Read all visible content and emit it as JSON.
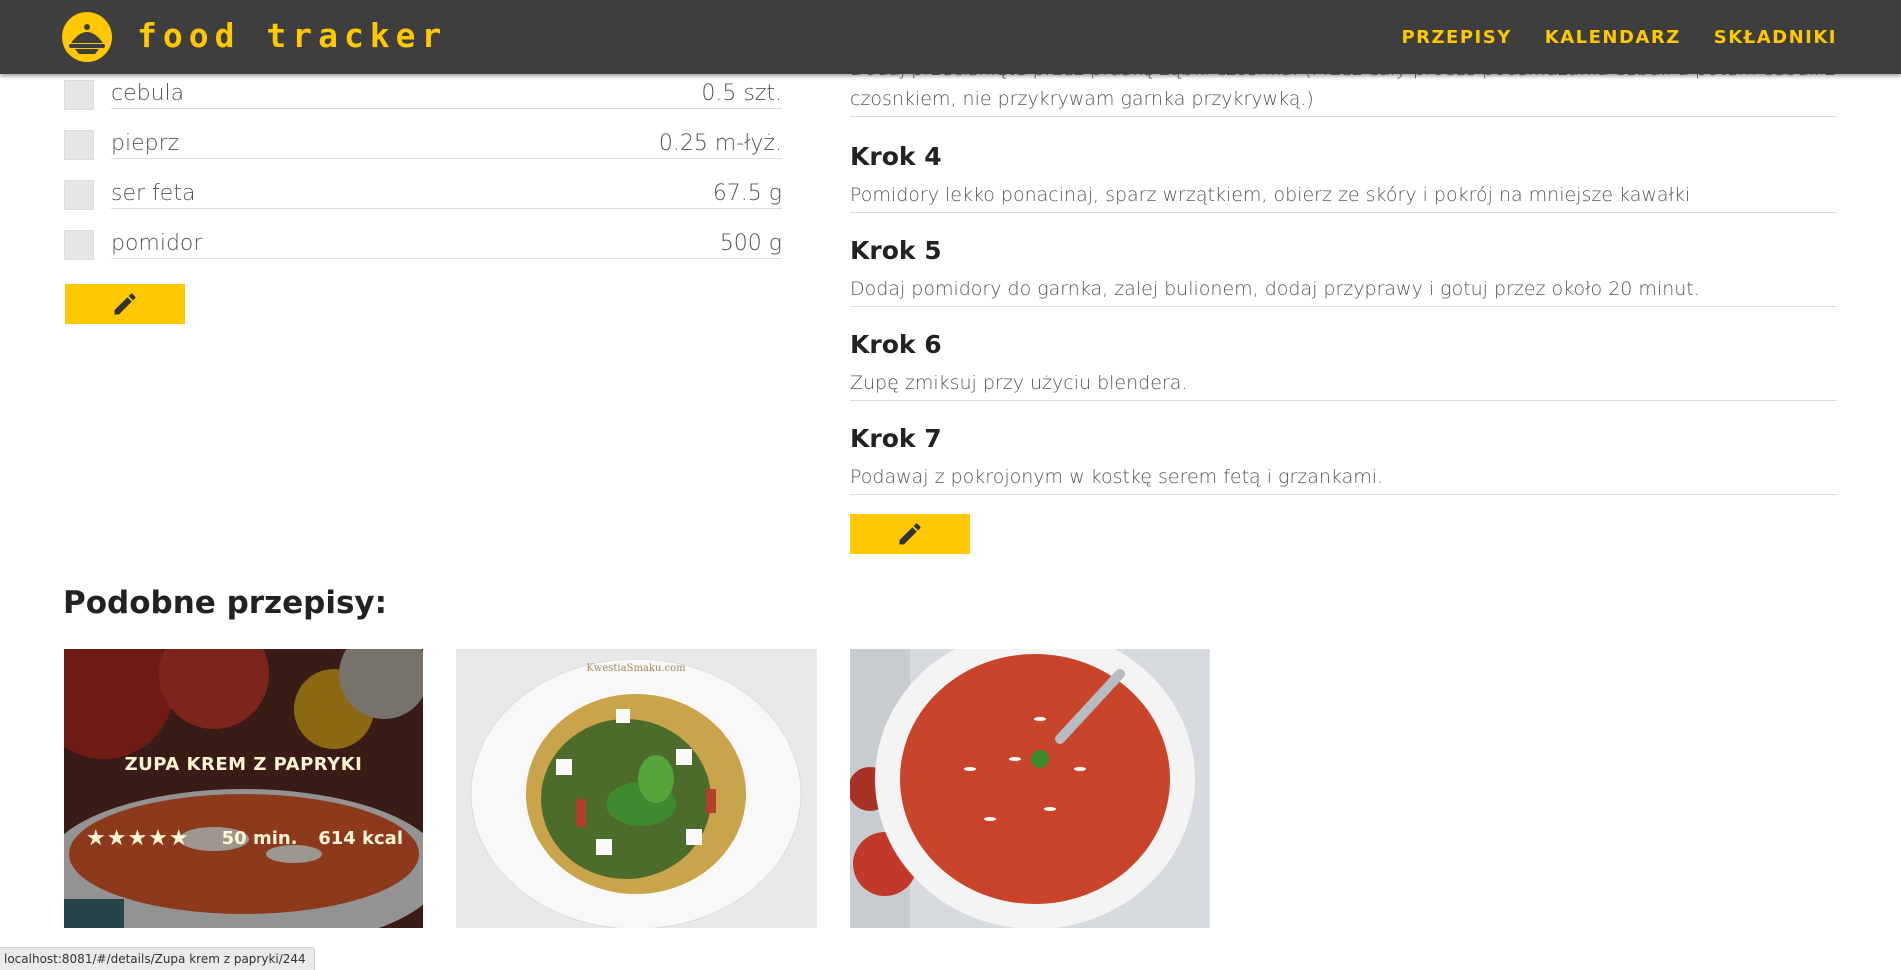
{
  "navbar": {
    "brand": "food tracker",
    "links": [
      "PRZEPISY",
      "KALENDARZ",
      "SKŁADNIKI"
    ],
    "colors": {
      "background": "#3e3e3e",
      "accent": "#ffc800"
    }
  },
  "ingredients": [
    {
      "name": "cebula",
      "qty": "0.5 szt."
    },
    {
      "name": "pieprz",
      "qty": "0.25 m-łyż."
    },
    {
      "name": "ser feta",
      "qty": "67.5 g"
    },
    {
      "name": "pomidor",
      "qty": "500 g"
    }
  ],
  "steps": {
    "partial_text": "Dodaj przeciśnięte przez praskę ząbki czosnku. (Przez cały proces podsmażania cebuli a potem cebuli z czosnkiem, nie przykrywam garnka przykrywką.)",
    "partial_line2": "czosnkiem, nie przykrywam garnka przykrywką.)",
    "items": [
      {
        "title": "Krok 4",
        "text": "Pomidory lekko ponacinaj, sparz wrzątkiem, obierz ze skóry i pokrój na mniejsze kawałki"
      },
      {
        "title": "Krok 5",
        "text": "Dodaj pomidory do garnka, zalej bulionem, dodaj przyprawy i gotuj przez około 20 minut."
      },
      {
        "title": "Krok 6",
        "text": "Zupę zmiksuj przy użyciu blendera."
      },
      {
        "title": "Krok 7",
        "text": "Podawaj z pokrojonym w kostkę serem fetą i grzankami."
      }
    ]
  },
  "icons": {
    "edit": "pencil-icon",
    "logo": "cloche-logo-icon"
  },
  "similar": {
    "title": "Podobne przepisy:",
    "cards": [
      {
        "name": "ZUPA KREM Z PAPRYKI",
        "stars": "★★★★★",
        "time": "50 min.",
        "kcal": "614 kcal"
      },
      {
        "name": "",
        "watermark": "KwestiaSmaku.com"
      },
      {
        "name": ""
      }
    ]
  },
  "status_bar": "localhost:8081/#/details/Zupa krem z papryki/244"
}
